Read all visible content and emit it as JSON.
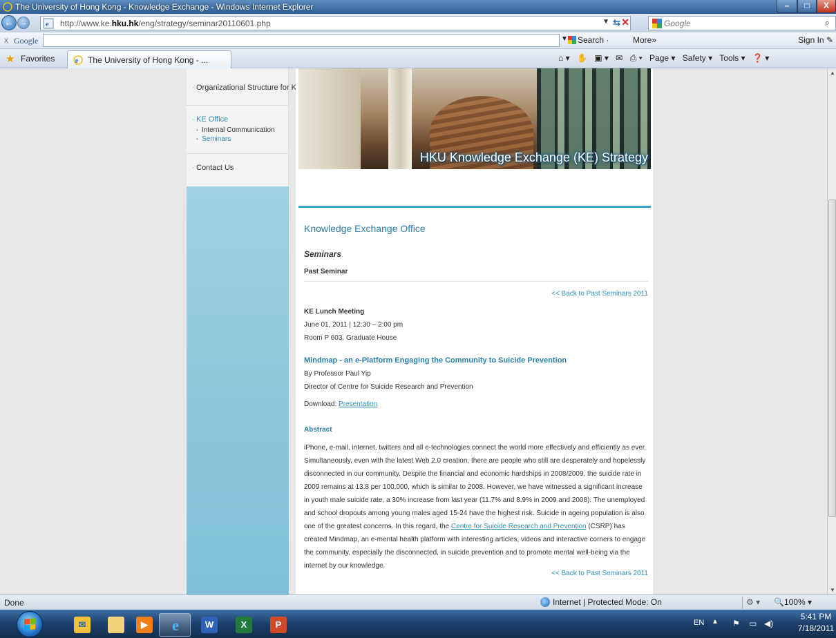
{
  "window": {
    "title": "The University of Hong Kong - Knowledge Exchange - Windows Internet Explorer",
    "minimize": "–",
    "maximize": "□",
    "close": "X"
  },
  "address": {
    "url_prefix": "http://www.ke.",
    "url_domain": "hku.hk",
    "url_path": "/eng/strategy/seminar20110601.php",
    "search_placeholder": "Google"
  },
  "google_toolbar": {
    "close": "x",
    "label": "Google",
    "search": "Search ·",
    "more": "More»",
    "sign_in": "Sign In"
  },
  "favorites": {
    "label": "Favorites",
    "tab_label": "The University of Hong Kong - ...",
    "tools": [
      "Page ▾",
      "Safety ▾",
      "Tools ▾"
    ]
  },
  "sidebar": {
    "items": [
      {
        "label": "Organizational Structure for KE"
      },
      {
        "label": "KE Office",
        "subs": [
          "Internal Communication",
          "Seminars"
        ]
      },
      {
        "label": "Contact Us"
      }
    ]
  },
  "banner": {
    "title": "HKU Knowledge Exchange (KE) Strategy"
  },
  "main": {
    "heading": "Knowledge Exchange Office",
    "section": "Seminars",
    "subsection": "Past Seminar",
    "back_link": "<< Back to Past Seminars 2011",
    "event_type": "KE Lunch Meeting",
    "event_datetime": "June 01, 2011  |  12:30 – 2:00 pm",
    "event_venue": "Room P 603, Graduate House",
    "talk_title": "Mindmap - an e-Platform Engaging the Community to Suicide Prevention",
    "speaker": "By Professor Paul Yip",
    "speaker_role": "Director of Centre for Suicide Research and Prevention",
    "download_label": "Download:",
    "download_link": "Presentation",
    "abstract_heading": "Abstract",
    "abstract_part1": "iPhone, e-mail, internet, twitters and all e-technologies connect the world more effectively and efficiently as ever. Simultaneously, even with the latest Web 2.0 creation, there are people who still are desperately and hopelessly disconnected in our community. Despite the financial and economic hardships in 2008/2009, the suicide rate in 2009 remains at 13.8 per 100,000, which is similar to 2008. However, we have witnessed a significant increase in youth male suicide rate, a 30% increase from last year (11.7% and 8.9% in 2009 and 2008). The unemployed and school dropouts among young males aged 15-24 have the highest risk. Suicide in ageing population is also one of the greatest concerns. In this regard, the ",
    "abstract_link": "Centre for Suicide Research and Prevention",
    "abstract_part2": " (CSRP) has created Mindmap, an e-mental health platform with interesting articles, videos and interactive corners to engage the community, especially the disconnected, in suicide prevention and to promote mental well-being via the internet by our knowledge."
  },
  "status": {
    "done": "Done",
    "zone": "Internet | Protected Mode: On",
    "zoom": "100%"
  },
  "taskbar": {
    "lang": "EN",
    "time": "5:41 PM",
    "date": "7/18/2011"
  }
}
